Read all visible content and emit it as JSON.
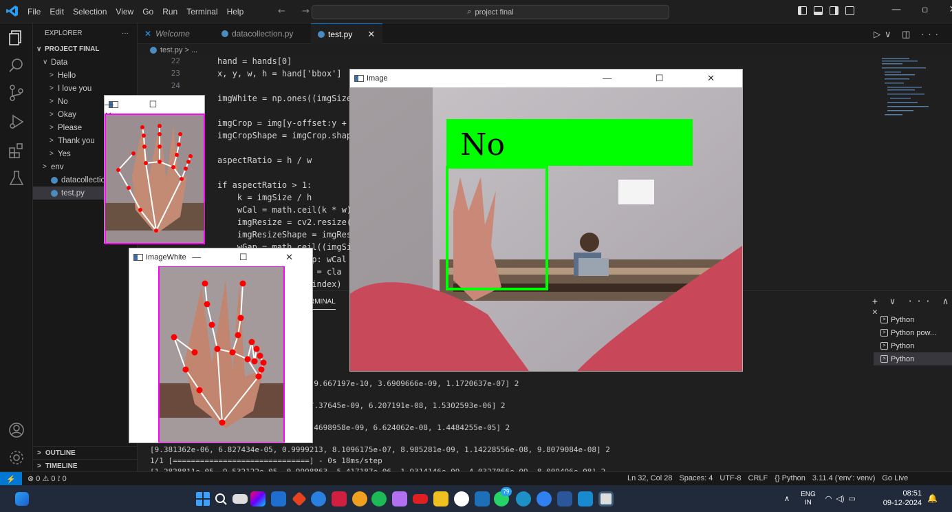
{
  "menu": [
    "File",
    "Edit",
    "Selection",
    "View",
    "Go",
    "Run",
    "Terminal",
    "Help"
  ],
  "nav_arrows": "← →",
  "search_placeholder": "project final",
  "tabs": [
    {
      "label": "Welcome"
    },
    {
      "label": "datacollection.py"
    },
    {
      "label": "test.py"
    }
  ],
  "tab_close": "✕",
  "explorer": {
    "title": "EXPLORER",
    "more": "···",
    "project": "PROJECT FINAL",
    "items": [
      {
        "label": "Data",
        "chev": "∨",
        "indent": 1
      },
      {
        "label": "Hello",
        "chev": ">",
        "indent": 2
      },
      {
        "label": "I love you",
        "chev": ">",
        "indent": 2
      },
      {
        "label": "No",
        "chev": ">",
        "indent": 2
      },
      {
        "label": "Okay",
        "chev": ">",
        "indent": 2
      },
      {
        "label": "Please",
        "chev": ">",
        "indent": 2
      },
      {
        "label": "Thank you",
        "chev": ">",
        "indent": 2
      },
      {
        "label": "Yes",
        "chev": ">",
        "indent": 2
      },
      {
        "label": "env",
        "chev": ">",
        "indent": 1
      },
      {
        "label": "datacollection.py",
        "chev": "",
        "indent": 1,
        "py": true
      },
      {
        "label": "test.py",
        "chev": "",
        "indent": 1,
        "py": true,
        "selected": true
      }
    ],
    "outline": "OUTLINE",
    "timeline": "TIMELINE"
  },
  "breadcrumb": "test.py > ...",
  "editor": {
    "line_numbers": [
      "22",
      "23",
      "24",
      "25",
      "",
      "",
      "",
      "",
      "",
      "",
      "",
      "",
      "",
      "",
      "",
      ""
    ],
    "lines": [
      "hand = hands[0]",
      "x, y, w, h = hand['bbox']",
      "",
      "imgWhite = np.ones((imgSize,",
      "",
      "imgCrop = img[y-offset:y + h",
      "imgCropShape = imgCrop.shape",
      "",
      "aspectRatio = h / w",
      "",
      "if aspectRatio > 1:",
      "    k = imgSize / h",
      "    wCal = math.ceil(k * w)",
      "    imgResize = cv2.resize(i",
      "    imgResizeShape = imgResi",
      "    wGap = math.ceil((imgSiz",
      "    imgWhite[:, wGap: wCal +",
      "                 ex = cla",
      "                 , index)"
    ]
  },
  "panel": {
    "tab": "RMINAL",
    "actions": "+ ∨ ··· ∧ ✕",
    "terminal_lines": [
      "                 22, 0.00",
      "                 - 0s 19m",
      "                 718, 5.5",
      "                 - 0s 19m",
      "                 314, 1.0",
      "                 - 0s 18ms/step",
      "                 94, 5.5068645e-06, 9.667197e-10, 3.6909666e-09, 1.1720637e-07] 2",
      "                 - 0s 20ms/step",
      "                 43, 0.0003315406, 7.37645e-09, 6.207191e-08, 1.5302593e-06] 2",
      "                 - 0s 19ms/step",
      "                 63, 0.000380092, 2.4698958e-09, 6.624062e-08, 1.4484255e-05] 2",
      "                 - 0s 20ms/step",
      "[9.381362e-06, 6.827434e-05, 0.9999213, 8.1096175e-07, 8.985281e-09, 1.14228556e-08, 9.8079084e-08] 2",
      "1/1 [==============================] - 0s 18ms/step",
      "[1.2828811e-05, 9.532122e-05, 0.9998863, 5.417187e-06, 1.9314146e-09, 4.0327066e-09, 8.009496e-08] 2"
    ],
    "terminals": [
      "Python",
      "Python pow...",
      "Python",
      "Python"
    ]
  },
  "status": {
    "remote": "⚡",
    "left": "⊗ 0 ⚠ 0   ⟟ 0",
    "right": [
      "Ln 32, Col 28",
      "Spaces: 4",
      "UTF-8",
      "CRLF",
      "{} Python",
      "3.11.4 ('env': venv)",
      "Go Live"
    ]
  },
  "image_window": {
    "title": "Image",
    "ctrls": "— ☐ ✕",
    "prediction": "No"
  },
  "small_window": {
    "ctrls": "— ☐ ✕"
  },
  "white_window": {
    "title": "ImageWhite",
    "ctrls": "— ☐ ✕"
  },
  "taskbar": {
    "lang": "ENG",
    "region": "IN",
    "time": "08:51",
    "date": "09-12-2024",
    "badge": "79",
    "caret": "∧"
  },
  "colors": {
    "accent": "#0078d4",
    "prediction_box": "#00ff00",
    "landmark": "#ff0000",
    "crop_border": "#ff00ff"
  }
}
